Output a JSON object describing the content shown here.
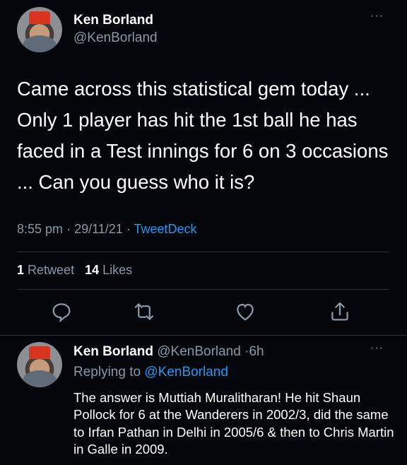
{
  "main_tweet": {
    "author_name": "Ken Borland",
    "author_handle": "@KenBorland",
    "more_icon": "···",
    "text": "Came across this statistical gem today ... Only 1 player has hit the 1st ball he has faced in a Test innings for 6 on 3 occasions ... Can you guess who it is?",
    "time": "8:55 pm",
    "date": "29/11/21",
    "source": "TweetDeck",
    "separator": "·",
    "retweets_count": "1",
    "retweets_label": "Retweet",
    "likes_count": "14",
    "likes_label": "Likes"
  },
  "actions": [
    "reply-icon",
    "retweet-icon",
    "like-icon",
    "share-icon"
  ],
  "reply_tweet": {
    "author_name": "Ken Borland",
    "author_handle": "@KenBorland",
    "separator": "·",
    "age": "6h",
    "more_icon": "···",
    "replying_label": "Replying to",
    "replying_to": "@KenBorland",
    "text": "The answer is Muttiah Muralitharan! He hit Shaun Pollock for 6 at the Wanderers in 2002/3, did the same to Irfan Pathan in Delhi in 2005/6 & then to Chris Martin in Galle in 2009."
  },
  "colors": {
    "background": "#03060a",
    "text": "#ffffff",
    "muted": "#8b98a5",
    "accent": "#1d9bf0",
    "divider": "#2f3336"
  }
}
